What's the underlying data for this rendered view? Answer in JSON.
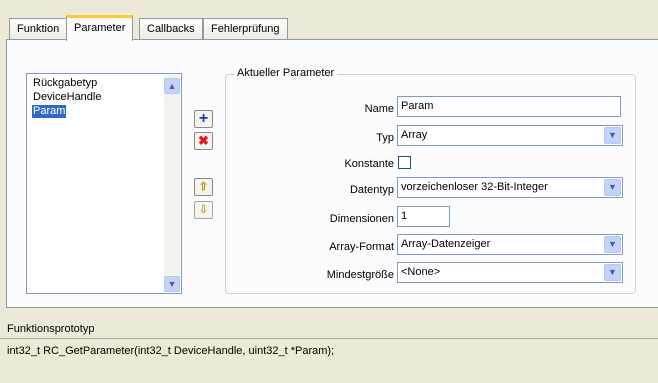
{
  "tabs": [
    {
      "label": "Funktion",
      "active": false
    },
    {
      "label": "Parameter",
      "active": true
    },
    {
      "label": "Callbacks",
      "active": false
    },
    {
      "label": "Fehlerprüfung",
      "active": false
    }
  ],
  "parameter_list": {
    "items": [
      {
        "label": "Rückgabetyp",
        "selected": false
      },
      {
        "label": "DeviceHandle",
        "selected": false
      },
      {
        "label": "Param",
        "selected": true
      }
    ]
  },
  "tools": {
    "add_icon": "plus-icon",
    "delete_icon": "delete-x-icon",
    "move_up_icon": "arrow-up-icon",
    "move_down_icon": "arrow-down-icon"
  },
  "current_param": {
    "title": "Aktueller Parameter",
    "name_label": "Name",
    "name_value": "Param",
    "type_label": "Typ",
    "type_value": "Array",
    "const_label": "Konstante",
    "const_checked": false,
    "datatype_label": "Datentyp",
    "datatype_value": "vorzeichenloser 32-Bit-Integer",
    "dimensions_label": "Dimensionen",
    "dimensions_value": "1",
    "array_format_label": "Array-Format",
    "array_format_value": "Array-Datenzeiger",
    "min_size_label": "Mindestgröße",
    "min_size_value": "<None>"
  },
  "prototype": {
    "label": "Funktionsprototyp",
    "value": "int32_t RC_GetParameter(int32_t DeviceHandle, uint32_t *Param);"
  },
  "colors": {
    "selection": "#316ac5",
    "active_tab_accent": "#ffc83c",
    "add_blue": "#1a3e9c",
    "delete_red": "#d81e1e",
    "arrow_yellow": "#e8c000"
  }
}
